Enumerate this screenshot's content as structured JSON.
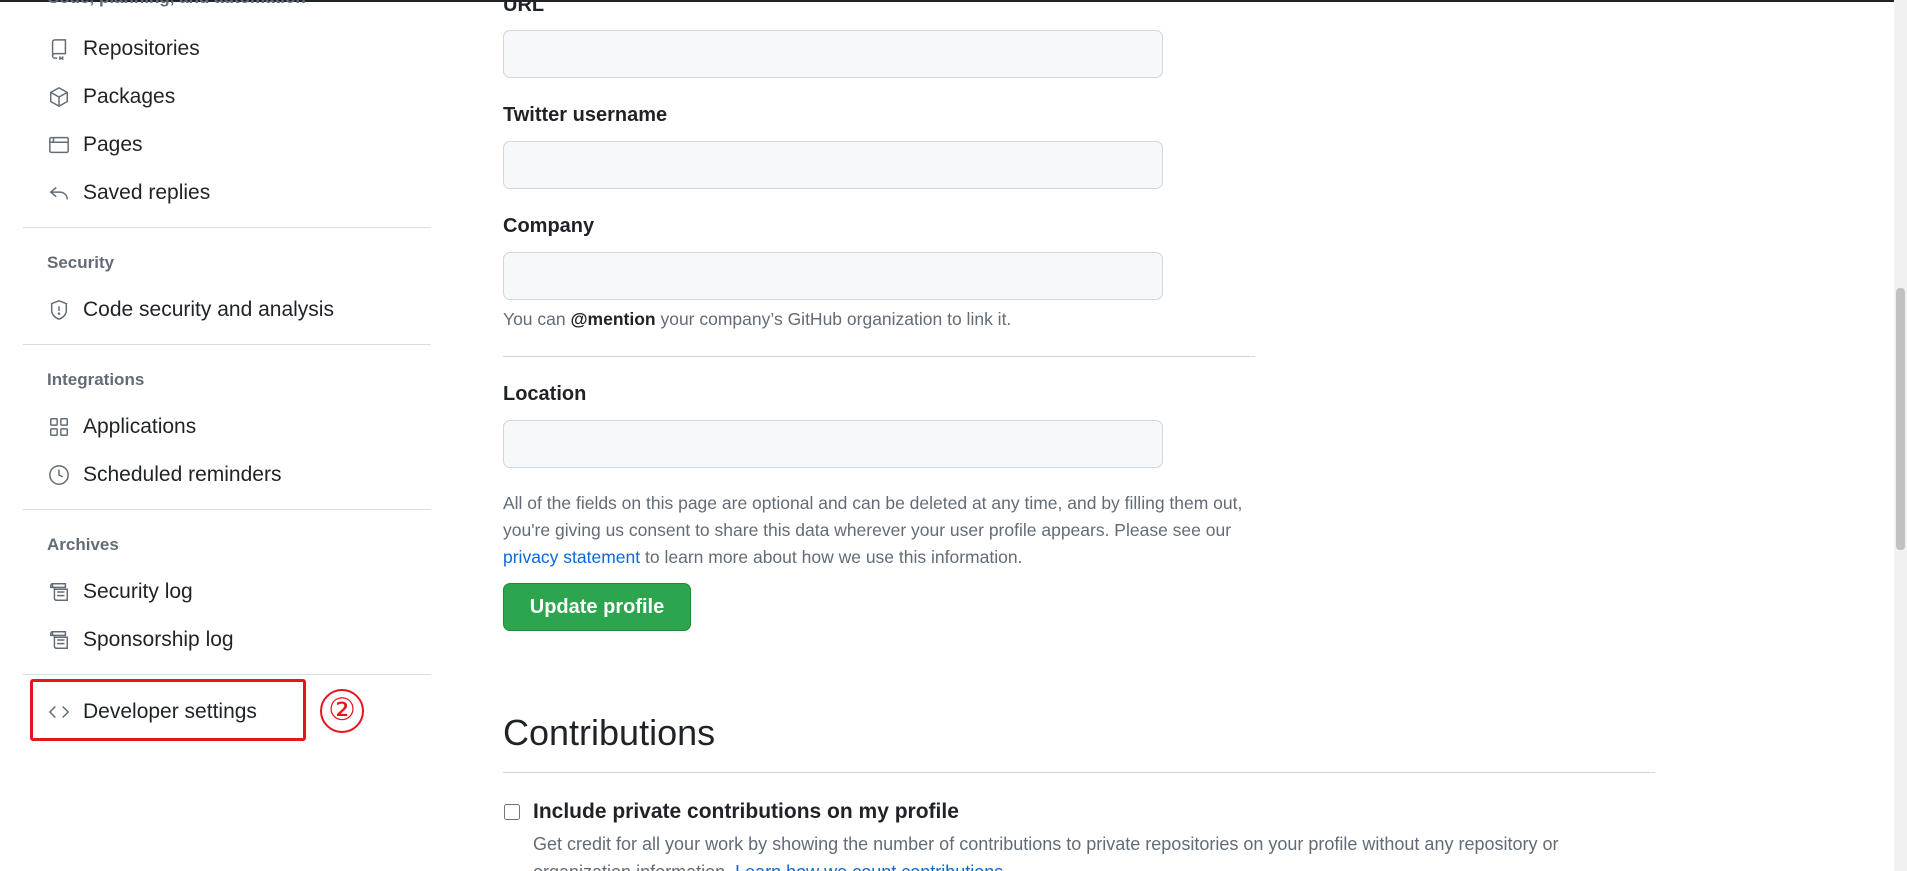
{
  "sidebar": {
    "top_heading": "Code, planning, and automation",
    "group1": [
      {
        "label": "Repositories",
        "icon": "repo-icon"
      },
      {
        "label": "Packages",
        "icon": "package-icon"
      },
      {
        "label": "Pages",
        "icon": "browser-icon"
      },
      {
        "label": "Saved replies",
        "icon": "reply-icon"
      }
    ],
    "security_heading": "Security",
    "security_items": [
      {
        "label": "Code security and analysis",
        "icon": "shield-icon"
      }
    ],
    "integrations_heading": "Integrations",
    "integrations_items": [
      {
        "label": "Applications",
        "icon": "apps-icon"
      },
      {
        "label": "Scheduled reminders",
        "icon": "clock-icon"
      }
    ],
    "archives_heading": "Archives",
    "archives_items": [
      {
        "label": "Security log",
        "icon": "log-icon"
      },
      {
        "label": "Sponsorship log",
        "icon": "log-icon"
      }
    ],
    "developer_settings": {
      "label": "Developer settings",
      "icon": "code-icon"
    }
  },
  "annotation": {
    "marker": "②",
    "highlight_color": "#e8141d"
  },
  "form": {
    "url_label": "URL",
    "url_value": "",
    "twitter_label": "Twitter username",
    "twitter_value": "",
    "company_label": "Company",
    "company_value": "",
    "company_note_prefix": "You can ",
    "company_note_bold": "@mention",
    "company_note_suffix": " your company’s GitHub organization to link it.",
    "location_label": "Location",
    "location_value": "",
    "privacy_note_prefix": "All of the fields on this page are optional and can be deleted at any time, and by filling them out, you're giving us consent to share this data wherever your user profile appears. Please see our ",
    "privacy_link": "privacy statement",
    "privacy_note_suffix": " to learn more about how we use this information.",
    "update_button": "Update profile"
  },
  "contributions": {
    "title": "Contributions",
    "checkbox_label": "Include private contributions on my profile",
    "checkbox_checked": false,
    "note_prefix": "Get credit for all your work by showing the number of contributions to private repositories on your profile without any repository or organization information. ",
    "note_link": "Learn how we count contributions."
  },
  "colors": {
    "accent_green": "#2da44e",
    "link_blue": "#0969da",
    "muted": "#636c76"
  }
}
